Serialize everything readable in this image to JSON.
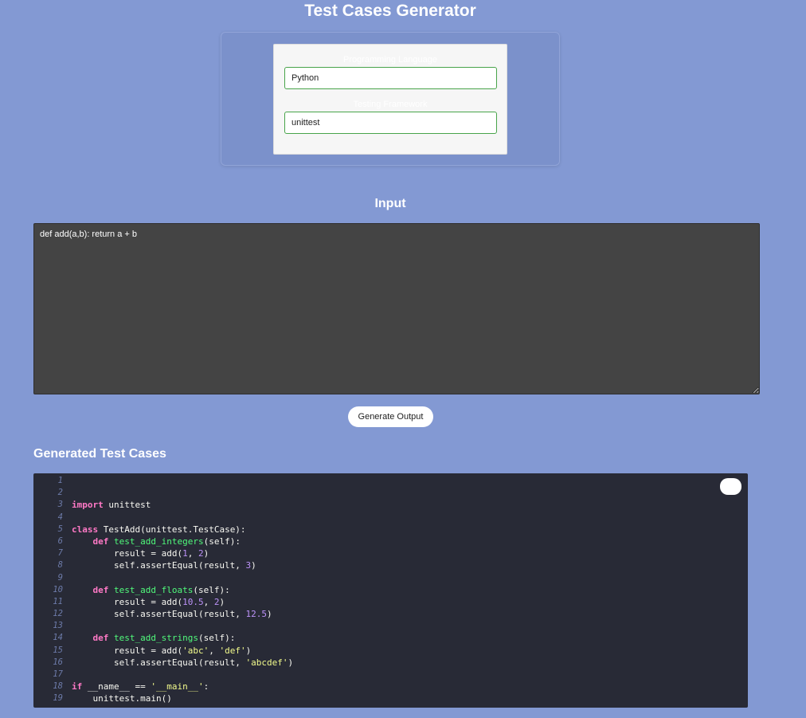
{
  "page": {
    "title": "Test Cases Generator"
  },
  "settings": {
    "language_label": "Programming Language",
    "language_value": "Python",
    "framework_label": "Testing Framework",
    "framework_value": "unittest"
  },
  "input": {
    "heading": "Input",
    "code": "def add(a,b): return a + b"
  },
  "actions": {
    "generate_label": "Generate Output"
  },
  "output": {
    "heading": "Generated Test Cases",
    "lines": [
      {
        "num": "1",
        "tokens": []
      },
      {
        "num": "2",
        "tokens": []
      },
      {
        "num": "3",
        "tokens": [
          {
            "t": "kw",
            "v": "import"
          },
          {
            "t": "plain",
            "v": " unittest"
          }
        ]
      },
      {
        "num": "4",
        "tokens": []
      },
      {
        "num": "5",
        "tokens": [
          {
            "t": "kw",
            "v": "class"
          },
          {
            "t": "plain",
            "v": " TestAdd(unittest.TestCase):"
          }
        ]
      },
      {
        "num": "6",
        "tokens": [
          {
            "t": "plain",
            "v": "    "
          },
          {
            "t": "kw",
            "v": "def"
          },
          {
            "t": "plain",
            "v": " "
          },
          {
            "t": "fn",
            "v": "test_add_integers"
          },
          {
            "t": "plain",
            "v": "(self):"
          }
        ]
      },
      {
        "num": "7",
        "tokens": [
          {
            "t": "plain",
            "v": "        result = add("
          },
          {
            "t": "num",
            "v": "1"
          },
          {
            "t": "plain",
            "v": ", "
          },
          {
            "t": "num",
            "v": "2"
          },
          {
            "t": "plain",
            "v": ")"
          }
        ]
      },
      {
        "num": "8",
        "tokens": [
          {
            "t": "plain",
            "v": "        self.assertEqual(result, "
          },
          {
            "t": "num",
            "v": "3"
          },
          {
            "t": "plain",
            "v": ")"
          }
        ]
      },
      {
        "num": "9",
        "tokens": []
      },
      {
        "num": "10",
        "tokens": [
          {
            "t": "plain",
            "v": "    "
          },
          {
            "t": "kw",
            "v": "def"
          },
          {
            "t": "plain",
            "v": " "
          },
          {
            "t": "fn",
            "v": "test_add_floats"
          },
          {
            "t": "plain",
            "v": "(self):"
          }
        ]
      },
      {
        "num": "11",
        "tokens": [
          {
            "t": "plain",
            "v": "        result = add("
          },
          {
            "t": "num",
            "v": "10.5"
          },
          {
            "t": "plain",
            "v": ", "
          },
          {
            "t": "num",
            "v": "2"
          },
          {
            "t": "plain",
            "v": ")"
          }
        ]
      },
      {
        "num": "12",
        "tokens": [
          {
            "t": "plain",
            "v": "        self.assertEqual(result, "
          },
          {
            "t": "num",
            "v": "12.5"
          },
          {
            "t": "plain",
            "v": ")"
          }
        ]
      },
      {
        "num": "13",
        "tokens": []
      },
      {
        "num": "14",
        "tokens": [
          {
            "t": "plain",
            "v": "    "
          },
          {
            "t": "kw",
            "v": "def"
          },
          {
            "t": "plain",
            "v": " "
          },
          {
            "t": "fn",
            "v": "test_add_strings"
          },
          {
            "t": "plain",
            "v": "(self):"
          }
        ]
      },
      {
        "num": "15",
        "tokens": [
          {
            "t": "plain",
            "v": "        result = add("
          },
          {
            "t": "str",
            "v": "'abc'"
          },
          {
            "t": "plain",
            "v": ", "
          },
          {
            "t": "str",
            "v": "'def'"
          },
          {
            "t": "plain",
            "v": ")"
          }
        ]
      },
      {
        "num": "16",
        "tokens": [
          {
            "t": "plain",
            "v": "        self.assertEqual(result, "
          },
          {
            "t": "str",
            "v": "'abcdef'"
          },
          {
            "t": "plain",
            "v": ")"
          }
        ]
      },
      {
        "num": "17",
        "tokens": []
      },
      {
        "num": "18",
        "tokens": [
          {
            "t": "kw",
            "v": "if"
          },
          {
            "t": "plain",
            "v": " __name__ == "
          },
          {
            "t": "str",
            "v": "'__main__'"
          },
          {
            "t": "plain",
            "v": ":"
          }
        ]
      },
      {
        "num": "19",
        "tokens": [
          {
            "t": "plain",
            "v": "    unittest.main()"
          }
        ]
      }
    ]
  },
  "colors": {
    "page_background": "#8399d3",
    "code_background": "#282a36",
    "input_background": "#444444",
    "field_border": "#48a44a"
  }
}
